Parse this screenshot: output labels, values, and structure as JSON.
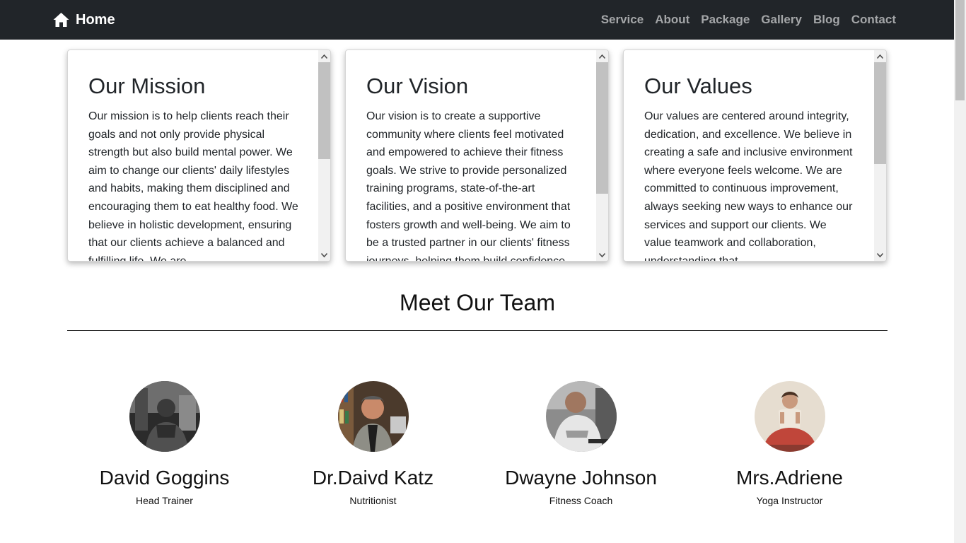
{
  "nav": {
    "brand": "Home",
    "links": [
      "Service",
      "About",
      "Package",
      "Gallery",
      "Blog",
      "Contact"
    ]
  },
  "cards": [
    {
      "title": "Our Mission",
      "text": "Our mission is to help clients reach their goals and not only provide physical strength but also build mental power. We aim to change our clients' daily lifestyles and habits, making them disciplined and encouraging them to eat healthy food. We believe in holistic development, ensuring that our clients achieve a balanced and fulfilling life. We are"
    },
    {
      "title": "Our Vision",
      "text": "Our vision is to create a supportive community where clients feel motivated and empowered to achieve their fitness goals. We strive to provide personalized training programs, state-of-the-art facilities, and a positive environment that fosters growth and well-being. We aim to be a trusted partner in our clients' fitness journeys, helping them build confidence"
    },
    {
      "title": "Our Values",
      "text": "Our values are centered around integrity, dedication, and excellence. We believe in creating a safe and inclusive environment where everyone feels welcome. We are committed to continuous improvement, always seeking new ways to enhance our services and support our clients. We value teamwork and collaboration, understanding that"
    }
  ],
  "team": {
    "heading": "Meet Our Team",
    "members": [
      {
        "name": "David Goggins",
        "role": "Head Trainer"
      },
      {
        "name": "Dr.Daivd Katz",
        "role": "Nutritionist"
      },
      {
        "name": "Dwayne Johnson",
        "role": "Fitness Coach"
      },
      {
        "name": "Mrs.Adriene",
        "role": "Yoga Instructor"
      }
    ]
  },
  "icons": {
    "brand": "home-icon",
    "scroll_up": "chevron-up-icon",
    "scroll_down": "chevron-down-icon"
  },
  "colors": {
    "navbar": "#212529",
    "nav_link": "#a4a6a8",
    "brand": "#ffffff"
  }
}
